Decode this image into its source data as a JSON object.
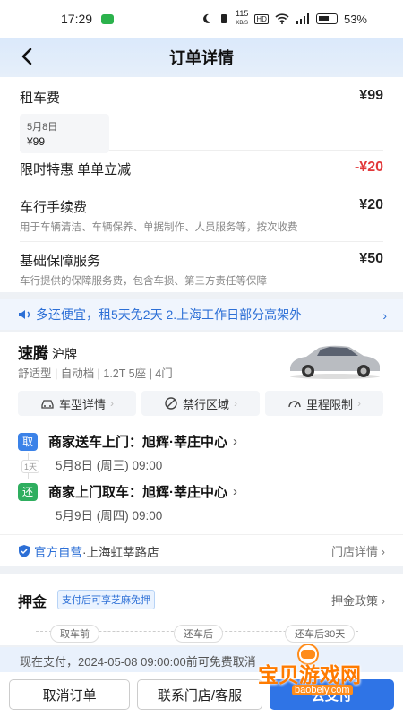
{
  "status_bar": {
    "time": "17:29",
    "net_speed": "115",
    "net_unit": "KB/S",
    "battery": "53%"
  },
  "header": {
    "title": "订单详情"
  },
  "fees": [
    {
      "label": "租车费",
      "amount": "¥99",
      "chip_date": "5月8日",
      "chip_price": "¥99"
    },
    {
      "label": "限时特惠 单单立减",
      "amount": "-¥20"
    },
    {
      "label": "车行手续费",
      "amount": "¥20",
      "desc": "用于车辆清洁、车辆保养、单据制作、人员服务等，按次收费"
    },
    {
      "label": "基础保障服务",
      "amount": "¥50",
      "desc": "车行提供的保障服务费，包含车损、第三方责任等保障"
    }
  ],
  "promo": {
    "text": "多还便宜，租5天免2天 2.上海工作日部分高架外"
  },
  "car": {
    "name": "速腾",
    "plate": "沪牌",
    "spec": "舒适型 | 自动档 | 1.2T  5座 | 4门"
  },
  "pills": [
    {
      "label": "车型详情",
      "icon": "car-icon"
    },
    {
      "label": "禁行区域",
      "icon": "no-entry-icon"
    },
    {
      "label": "里程限制",
      "icon": "gauge-icon"
    }
  ],
  "pickup": {
    "tag": "取",
    "title": "商家送车上门：旭辉·莘庄中心",
    "time": "5月8日 (周三) 09:00"
  },
  "return": {
    "tag": "还",
    "title": "商家上门取车：旭辉·莘庄中心",
    "time": "5月9日 (周四) 09:00"
  },
  "duration": "1天",
  "store": {
    "badge": "官方自营",
    "name": "·上海虹莘路店",
    "detail": "门店详情"
  },
  "deposit": {
    "title": "押金",
    "badge": "支付后可享芝麻免押",
    "policy": "押金政策",
    "nodes": [
      "取车前",
      "还车后",
      "还车后30天"
    ]
  },
  "notice": "现在支付，2024-05-08 09:00:00前可免费取消",
  "footer": {
    "cancel": "取消订单",
    "contact": "联系门店/客服",
    "pay": "去支付"
  },
  "watermark": {
    "text": "宝贝游戏网",
    "url": "baobeiy.com"
  },
  "colors": {
    "accent": "#2f74e6",
    "discount": "#e2383a",
    "pickup_tag": "#3b82e8",
    "return_tag": "#2fae5f"
  }
}
